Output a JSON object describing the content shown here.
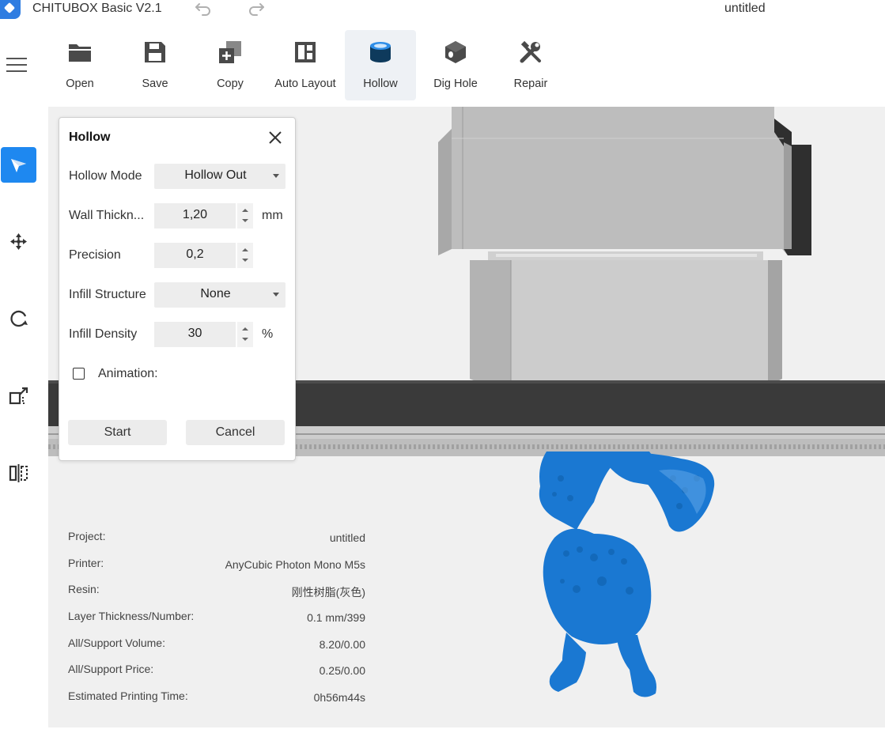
{
  "app": {
    "title": "CHITUBOX Basic V2.1",
    "document_name": "untitled"
  },
  "toolbar": {
    "tools": [
      {
        "label": "Open",
        "icon": "folder-icon"
      },
      {
        "label": "Save",
        "icon": "floppy-disk-icon"
      },
      {
        "label": "Copy",
        "icon": "copy-plus-icon"
      },
      {
        "label": "Auto Layout",
        "icon": "layout-grid-icon"
      },
      {
        "label": "Hollow",
        "icon": "hollow-cylinder-icon",
        "active": true
      },
      {
        "label": "Dig Hole",
        "icon": "dig-hole-cube-icon"
      },
      {
        "label": "Repair",
        "icon": "wrench-screwdriver-icon"
      }
    ]
  },
  "sidebar": {
    "items": [
      "select-tool-icon",
      "move-tool-icon",
      "rotate-tool-icon",
      "scale-tool-icon",
      "mirror-tool-icon"
    ],
    "active": "select-tool-icon"
  },
  "hollow_panel": {
    "title": "Hollow",
    "hollow_mode": {
      "label": "Hollow Mode",
      "value": "Hollow Out"
    },
    "wall_thickness": {
      "label": "Wall Thickn...",
      "value": "1,20",
      "unit": "mm"
    },
    "precision": {
      "label": "Precision",
      "value": "0,2"
    },
    "infill_structure": {
      "label": "Infill Structure",
      "value": "None"
    },
    "infill_density": {
      "label": "Infill Density",
      "value": "30",
      "unit": "%"
    },
    "animation": {
      "label": "Animation:",
      "checked": false
    },
    "start_label": "Start",
    "cancel_label": "Cancel"
  },
  "info": {
    "rows": [
      {
        "key": "Project:",
        "value": "untitled"
      },
      {
        "key": "Printer:",
        "value": "AnyCubic Photon Mono M5s"
      },
      {
        "key": "Resin:",
        "value": "刚性树脂(灰色)"
      },
      {
        "key": "Layer Thickness/Number:",
        "value": "0.1 mm/399"
      },
      {
        "key": "All/Support Volume:",
        "value": "8.20/0.00"
      },
      {
        "key": "All/Support Price:",
        "value": "0.25/0.00"
      },
      {
        "key": "Estimated Printing Time:",
        "value": "0h56m44s"
      }
    ]
  },
  "colors": {
    "accent": "#1e88f0",
    "model": "#1a78d2",
    "printer_head": "#bdbdbd",
    "build_plate": "#3a3a3a"
  }
}
